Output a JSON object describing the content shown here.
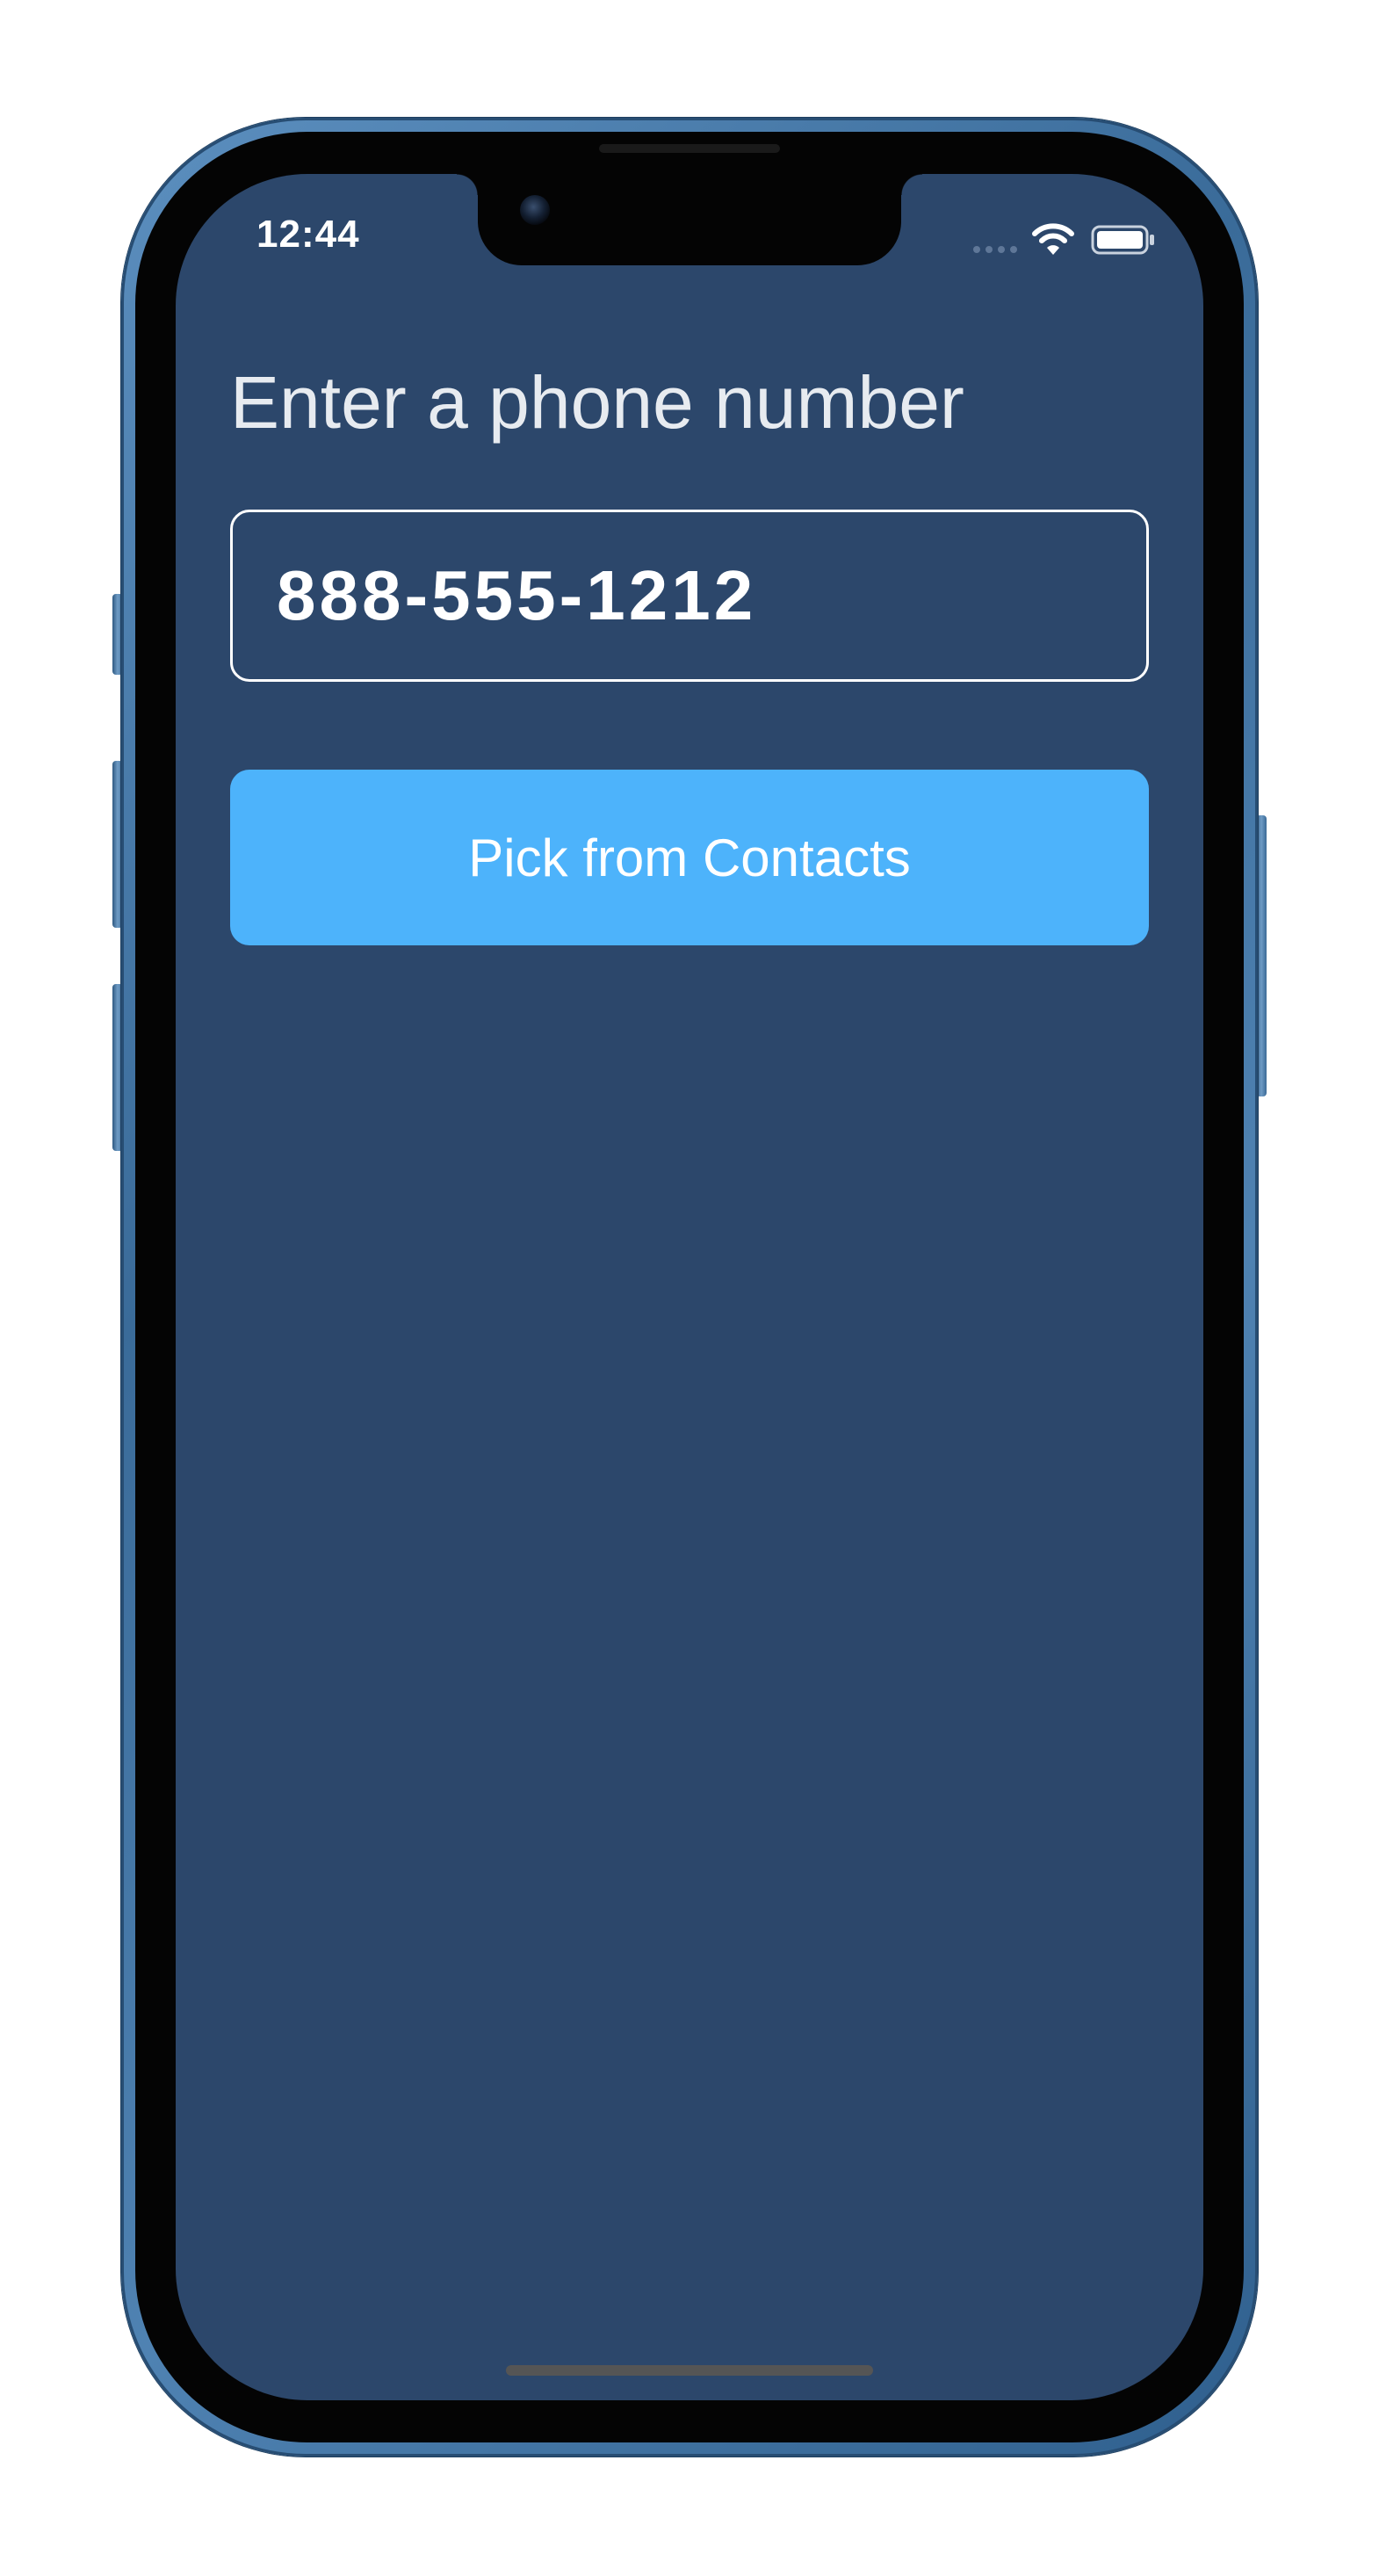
{
  "status_bar": {
    "time": "12:44",
    "icons": [
      "cellular-signal-icon",
      "wifi-icon",
      "battery-icon"
    ]
  },
  "main": {
    "title": "Enter a phone number",
    "phone_input": {
      "value": "888-555-1212"
    },
    "pick_button_label": "Pick from Contacts"
  },
  "colors": {
    "screen_background": "#2c476b",
    "button_background": "#4db3fb",
    "text": "#ffffff",
    "phone_frame": "#3a6b99"
  }
}
